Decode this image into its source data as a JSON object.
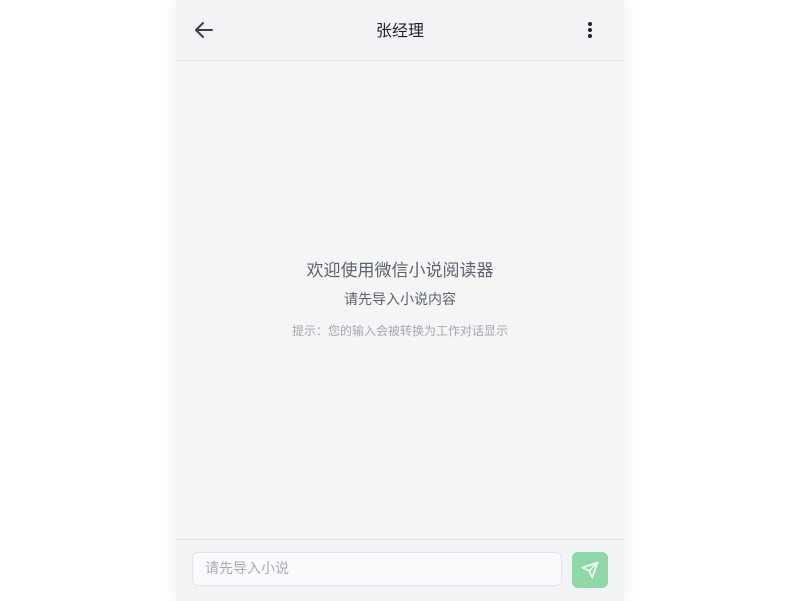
{
  "header": {
    "title": "张经理",
    "back_icon": "arrow-left-icon",
    "more_icon": "more-vertical-icon"
  },
  "main": {
    "welcome_title": "欢迎使用微信小说阅读器",
    "welcome_subtitle": "请先导入小说内容",
    "hint": "提示：您的输入会被转换为工作对话显示"
  },
  "footer": {
    "input_placeholder": "请先导入小说",
    "input_value": "",
    "send_icon": "send-icon",
    "send_color": "#8fd9a8"
  }
}
